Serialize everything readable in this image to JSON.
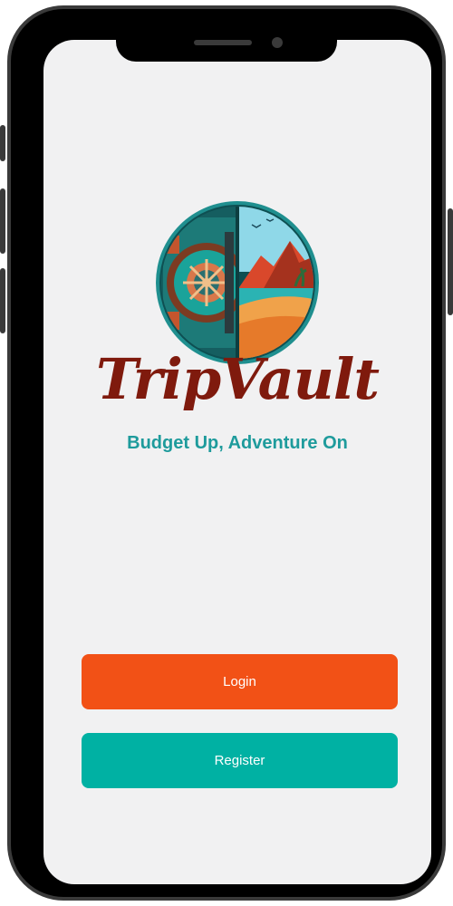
{
  "app": {
    "title": "TripVault",
    "tagline": "Budget Up, Adventure On"
  },
  "buttons": {
    "login_label": "Login",
    "register_label": "Register"
  },
  "colors": {
    "login_bg": "#f25116",
    "register_bg": "#00b1a3",
    "title_color": "#7f1a0d",
    "tagline_color": "#1e9b9c",
    "screen_bg": "#f1f1f2"
  },
  "icons": [
    "vault-door-icon",
    "beach-scene-icon"
  ]
}
